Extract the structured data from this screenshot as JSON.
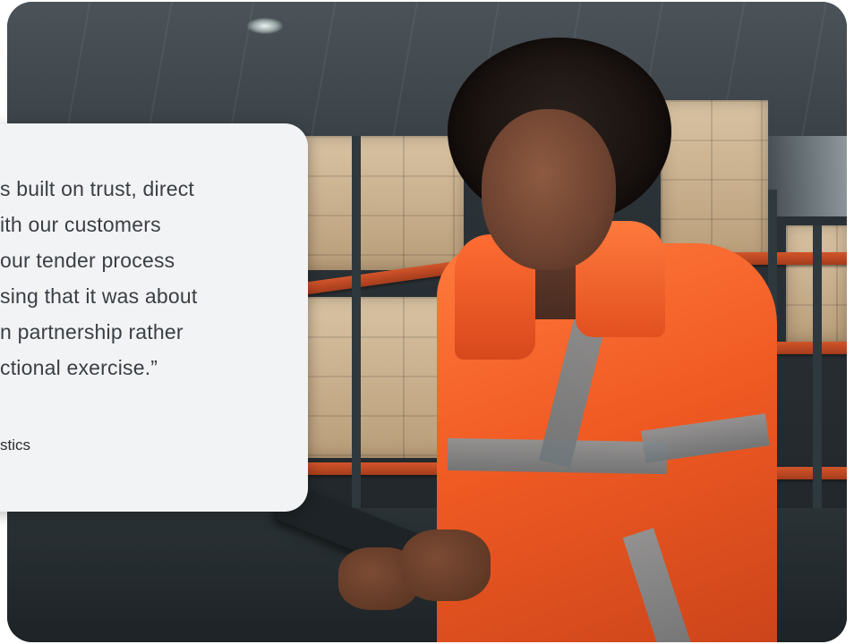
{
  "hero": {
    "image_alt": "Warehouse worker in high-visibility orange jacket holding a tablet",
    "colors": {
      "jacket": "#f05a23",
      "card_bg": "#f2f3f4",
      "quote_text": "#3a3f44"
    }
  },
  "testimonial": {
    "quote_lines": [
      "s built on trust, direct",
      "ith our customers",
      "our tender process",
      "sing that it was about",
      "n partnership rather",
      "ctional exercise.”"
    ],
    "author_company": "stics"
  }
}
